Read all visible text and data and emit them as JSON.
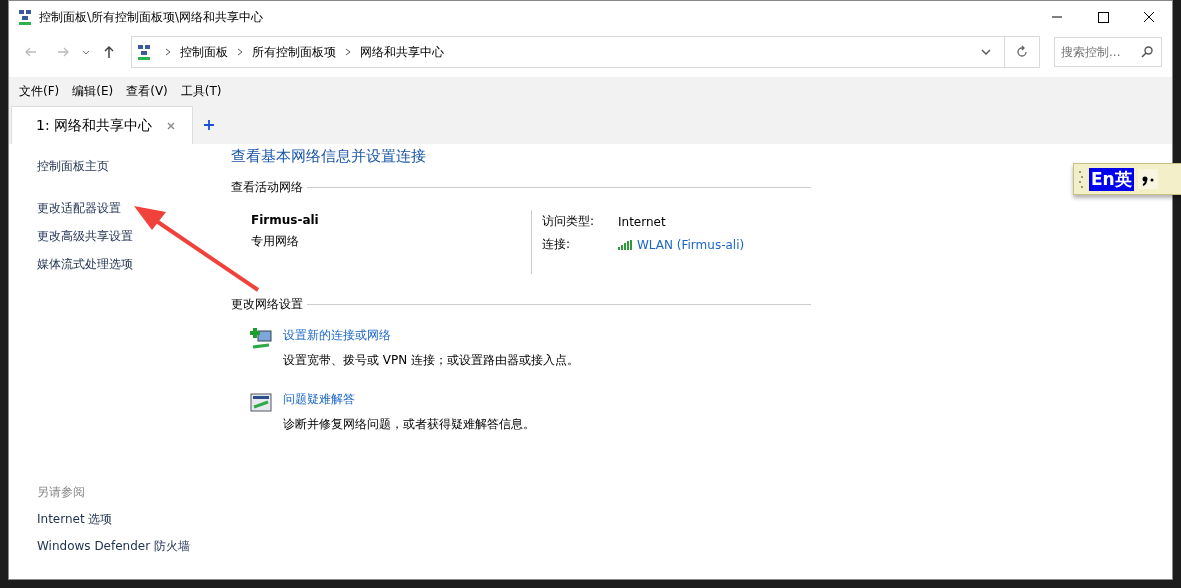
{
  "window": {
    "title": "控制面板\\所有控制面板项\\网络和共享中心"
  },
  "address_bar": {
    "crumbs": [
      "控制面板",
      "所有控制面板项",
      "网络和共享中心"
    ]
  },
  "search": {
    "placeholder": "搜索控制..."
  },
  "menu": [
    "文件(F)",
    "编辑(E)",
    "查看(V)",
    "工具(T)"
  ],
  "tabs": [
    {
      "label": "1: 网络和共享中心",
      "selected": true
    }
  ],
  "sidebar": {
    "items": [
      "控制面板主页",
      "更改适配器设置",
      "更改高级共享设置",
      "媒体流式处理选项"
    ],
    "see_also_title": "另请参阅",
    "see_also": [
      "Internet 选项",
      "Windows Defender 防火墙"
    ]
  },
  "main": {
    "heading": "查看基本网络信息并设置连接",
    "active_section": "查看活动网络",
    "network": {
      "name": "Firmus-ali",
      "type": "专用网络",
      "access_label": "访问类型:",
      "access_value": "Internet",
      "connection_label": "连接:",
      "connection_value": "WLAN (Firmus-ali)"
    },
    "change_section": "更改网络设置",
    "tasks": [
      {
        "link": "设置新的连接或网络",
        "description": "设置宽带、拨号或 VPN 连接；或设置路由器或接入点。"
      },
      {
        "link": "问题疑难解答",
        "description": "诊断并修复网络问题，或者获得疑难解答信息。"
      }
    ]
  },
  "ime": {
    "mode": "En英"
  }
}
